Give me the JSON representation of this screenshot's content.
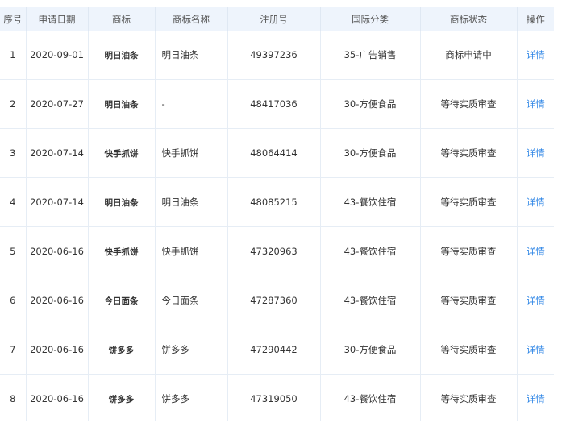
{
  "table": {
    "columns": [
      "序号",
      "申请日期",
      "商标",
      "商标名称",
      "注册号",
      "国际分类",
      "商标状态",
      "操作"
    ],
    "rows": [
      {
        "no": "1",
        "date": "2020-09-01",
        "mark": "明日油条",
        "name": "明日油条",
        "reg": "49397236",
        "cls": "35-广告销售",
        "status": "商标申请中",
        "action": "详情"
      },
      {
        "no": "2",
        "date": "2020-07-27",
        "mark": "明日油条",
        "name": "-",
        "reg": "48417036",
        "cls": "30-方便食品",
        "status": "等待实质审查",
        "action": "详情"
      },
      {
        "no": "3",
        "date": "2020-07-14",
        "mark": "快手抓饼",
        "name": "快手抓饼",
        "reg": "48064414",
        "cls": "30-方便食品",
        "status": "等待实质审查",
        "action": "详情"
      },
      {
        "no": "4",
        "date": "2020-07-14",
        "mark": "明日油条",
        "name": "明日油条",
        "reg": "48085215",
        "cls": "43-餐饮住宿",
        "status": "等待实质审查",
        "action": "详情"
      },
      {
        "no": "5",
        "date": "2020-06-16",
        "mark": "快手抓饼",
        "name": "快手抓饼",
        "reg": "47320963",
        "cls": "43-餐饮住宿",
        "status": "等待实质审查",
        "action": "详情"
      },
      {
        "no": "6",
        "date": "2020-06-16",
        "mark": "今日面条",
        "name": "今日面条",
        "reg": "47287360",
        "cls": "43-餐饮住宿",
        "status": "等待实质审查",
        "action": "详情"
      },
      {
        "no": "7",
        "date": "2020-06-16",
        "mark": "饼多多",
        "name": "饼多多",
        "reg": "47290442",
        "cls": "30-方便食品",
        "status": "等待实质审查",
        "action": "详情"
      },
      {
        "no": "8",
        "date": "2020-06-16",
        "mark": "饼多多",
        "name": "饼多多",
        "reg": "47319050",
        "cls": "43-餐饮住宿",
        "status": "等待实质审查",
        "action": "详情"
      }
    ]
  }
}
